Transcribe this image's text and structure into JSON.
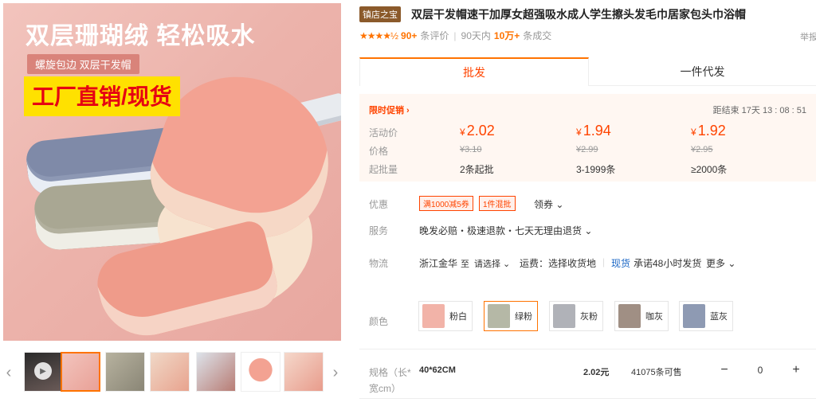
{
  "gallery": {
    "hero_title": "双层珊瑚绒 轻松吸水",
    "hero_tag": "螺旋包边 双层干发帽",
    "hero_ribbon": "工厂直销/现货",
    "prev_arrow": "‹",
    "next_arrow": "›",
    "play_icon": "▶"
  },
  "product": {
    "shop_badge": "镇店之宝",
    "title": "双层干发帽速干加厚女超强吸水成人学生擦头发毛巾居家包头巾浴帽",
    "report": "举报",
    "rating": {
      "stars": "★★★★½",
      "reviews_count": "90+",
      "reviews_label": "条评价",
      "sales_prefix": "90天内",
      "sales_count": "10万+",
      "sales_label": "条成交"
    }
  },
  "tabs": [
    {
      "label": "批发",
      "active": true
    },
    {
      "label": "一件代发",
      "active": false
    }
  ],
  "promo": {
    "label": "限时促销 ›",
    "countdown": "距结束  17天  13 : 08 : 51",
    "rows": {
      "active_price_label": "活动价",
      "original_price_label": "价格",
      "min_qty_label": "起批量"
    },
    "tiers": [
      {
        "price": "2.02",
        "original": "¥3.10",
        "qty": "2条起批"
      },
      {
        "price": "1.94",
        "original": "¥2.99",
        "qty": "3-1999条"
      },
      {
        "price": "1.92",
        "original": "¥2.95",
        "qty": "≥2000条"
      }
    ],
    "currency": "¥"
  },
  "benefits": {
    "label": "优惠",
    "coupons": [
      "满1000减5券",
      "1件混批"
    ],
    "claim": "领券 ⌄"
  },
  "service": {
    "label": "服务",
    "text": "晚发必赔・极速退款・七天无理由退货 ⌄"
  },
  "logistics": {
    "label": "物流",
    "from": "浙江金华",
    "to_label": "至",
    "select": "请选择 ⌄",
    "fee": "运费：选择收货地",
    "stock_status": "现货",
    "promise": "承诺48小时发货",
    "more": "更多 ⌄"
  },
  "colors": {
    "label": "颜色",
    "options": [
      {
        "label": "粉白",
        "selected": false,
        "swatch": "#f2b3a8"
      },
      {
        "label": "绿粉",
        "selected": true,
        "swatch": "#b5b8a6"
      },
      {
        "label": "灰粉",
        "selected": false,
        "swatch": "#b0b2b8"
      },
      {
        "label": "咖灰",
        "selected": false,
        "swatch": "#a08f84"
      },
      {
        "label": "蓝灰",
        "selected": false,
        "swatch": "#8e9ab3"
      }
    ]
  },
  "spec": {
    "label": "规格（长*宽cm）",
    "value": "40*62CM",
    "price": "2.02元",
    "stock": "41075条可售",
    "qty": "0",
    "minus": "−",
    "plus": "+"
  }
}
